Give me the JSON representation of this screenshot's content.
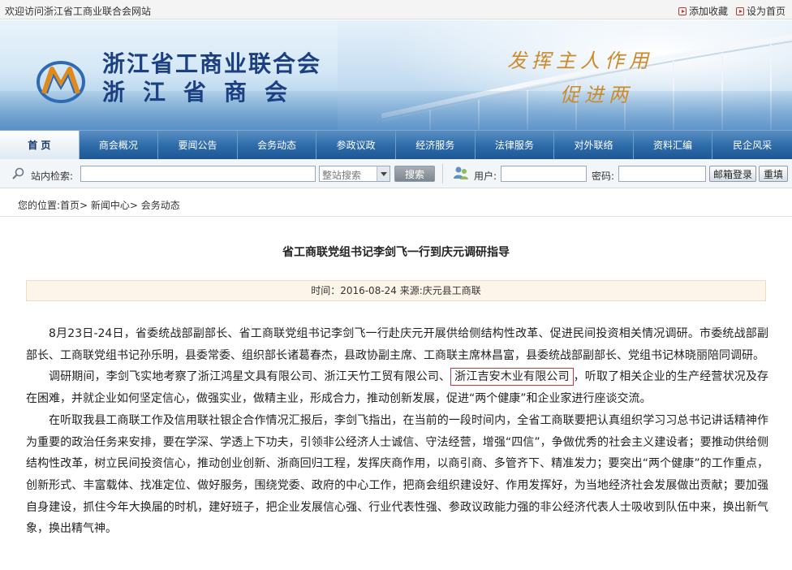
{
  "topbar": {
    "welcome": "欢迎访问浙江省工商业联合会网站",
    "favorite": "添加收藏",
    "homepage": "设为首页"
  },
  "banner": {
    "title_line1": "浙江省工商业联合会",
    "title_line2": "浙江省商会",
    "slogan_line1": "发挥主人作用",
    "slogan_line2": "促进两"
  },
  "nav": {
    "items": [
      "首 页",
      "商会概况",
      "要闻公告",
      "会务动态",
      "参政议政",
      "经济服务",
      "法律服务",
      "对外联络",
      "资料汇编",
      "民企风采"
    ]
  },
  "search": {
    "label": "站内检索:",
    "select_value": "整站搜索",
    "button": "搜索",
    "user_label": "用户:",
    "password_label": "密码:",
    "mail_login": "邮箱登录",
    "reset": "重填"
  },
  "breadcrumb": {
    "prefix": "您的位置:",
    "path": "首页> 新闻中心> 会务动态"
  },
  "article": {
    "title": "省工商联党组书记李剑飞一行到庆元调研指导",
    "meta": "时间：2016-08-24 来源:庆元县工商联",
    "p1": "8月23日-24日，省委统战部副部长、省工商联党组书记李剑飞一行赴庆元开展供给侧结构性改革、促进民间投资相关情况调研。市委统战部副部长、工商联党组书记孙乐明，县委常委、组织部长诸葛春杰，县政协副主席、工商联主席林昌富，县委统战部副部长、党组书记林晓丽陪同调研。",
    "p2_a": "调研期间，李剑飞实地考察了浙江鸿星文具有限公司、浙江天竹工贸有限公司、",
    "p2_highlight": "浙江吉安木业有限公司",
    "p2_b": "，听取了相关企业的生产经营状况及存在困难，并就企业如何坚定信心，做强实业，做精主业，形成合力，推动创新发展，促进“两个健康”和企业家进行座谈交流。",
    "p3": "在听取我县工商联工作及信用联社银企合作情况汇报后，李剑飞指出，在当前的一段时间内，全省工商联要把认真组织学习习总书记讲话精神作为重要的政治任务来安排，要在学深、学透上下功夫，引领非公经济人士诚信、守法经营，增强“四信”，争做优秀的社会主义建设者；要推动供给侧结构性改革，树立民间投资信心，推动创业创新、浙商回归工程，发挥庆商作用，以商引商、多管齐下、精准发力；要突出“两个健康”的工作重点，创新形式、丰富载体、找准定位、做好服务，围绕党委、政府的中心工作，把商会组织建设好、作用发挥好，为当地经济社会发展做出贡献；要加强自身建设，抓住今年大换届的时机，建好班子，把企业发展信心强、行业代表性强、参政议政能力强的非公经济代表人士吸收到队伍中来，换出新气象，换出精气神。"
  }
}
